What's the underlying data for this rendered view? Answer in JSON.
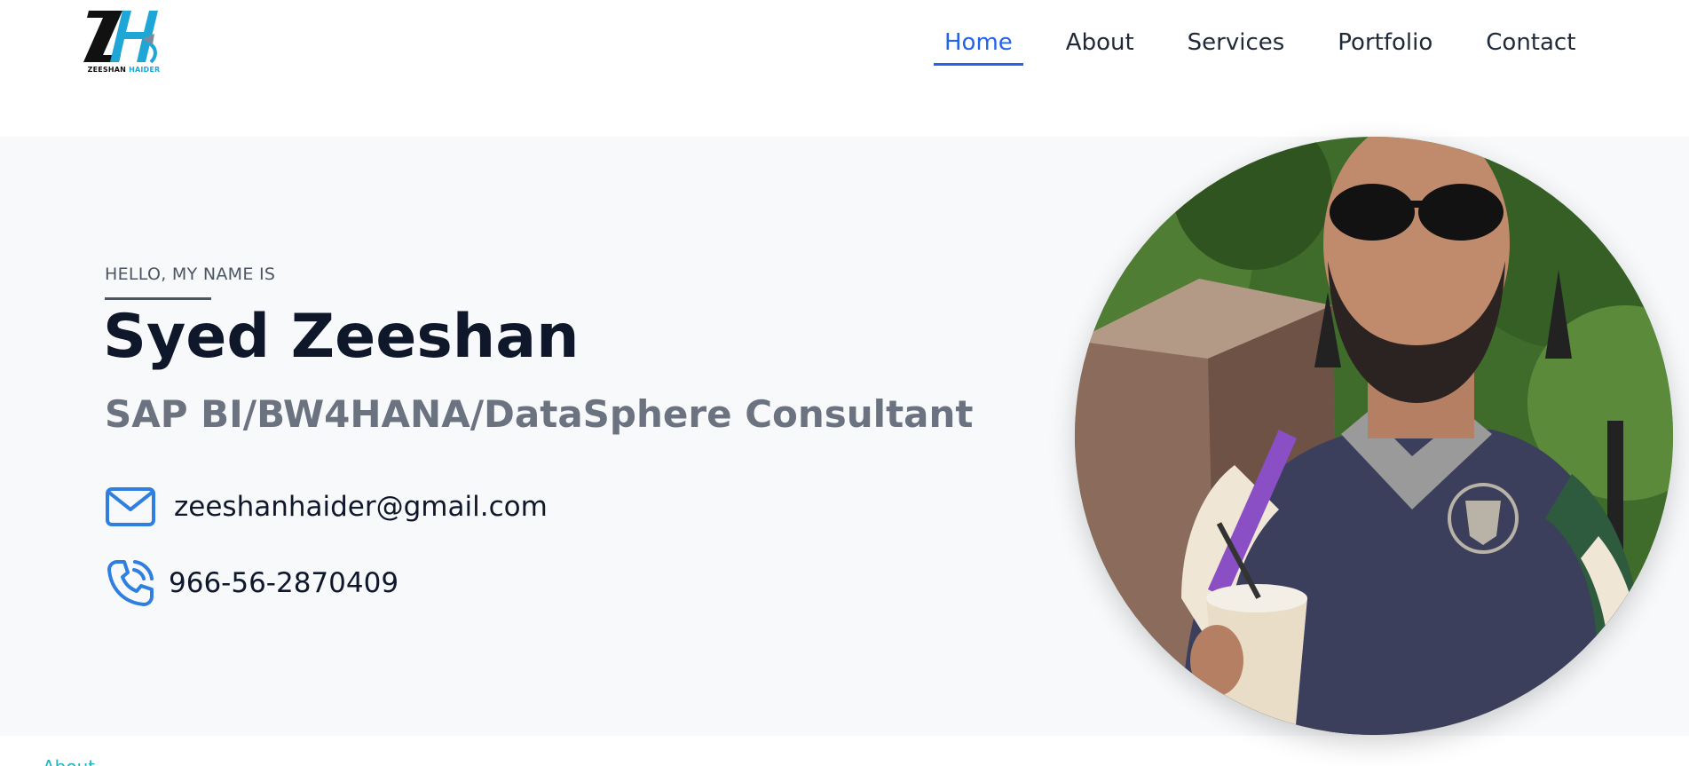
{
  "brand": {
    "monogram": "ZH",
    "name_first": "ZEESHAN",
    "name_second": "HAIDER",
    "accent_color": "#1ea7d6"
  },
  "nav": {
    "items": [
      {
        "label": "Home",
        "active": true
      },
      {
        "label": "About",
        "active": false
      },
      {
        "label": "Services",
        "active": false
      },
      {
        "label": "Portfolio",
        "active": false
      },
      {
        "label": "Contact",
        "active": false
      }
    ],
    "active_color": "#2563eb"
  },
  "hero": {
    "eyebrow": "HELLO, MY NAME IS",
    "name": "Syed Zeeshan",
    "role": "SAP BI/BW4HANA/DataSphere Consultant",
    "email": "zeeshanhaider@gmail.com",
    "phone": "966-56-2870409",
    "icons": {
      "email": "mail-icon",
      "phone": "phone-icon",
      "color": "#2f7fe0"
    },
    "photo": "profile-photo"
  },
  "next_section_peek": "About"
}
